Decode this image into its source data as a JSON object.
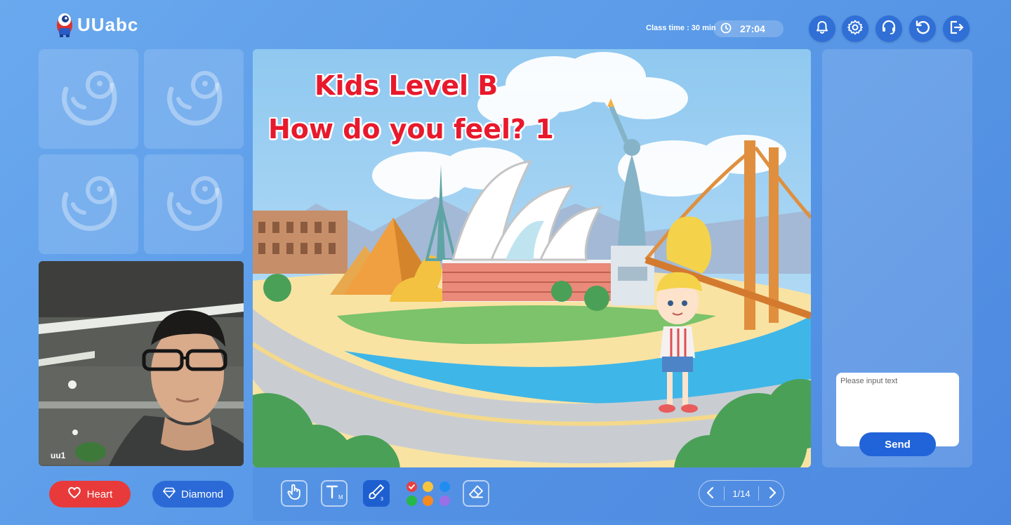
{
  "header": {
    "logo_text": "UUabc",
    "class_time_label": "Class time : 30 min",
    "timer": "27:04",
    "buttons": [
      {
        "name": "notifications-button",
        "icon": "bell-icon"
      },
      {
        "name": "settings-button",
        "icon": "gear-icon"
      },
      {
        "name": "support-button",
        "icon": "headset-icon"
      },
      {
        "name": "refresh-button",
        "icon": "refresh-icon"
      },
      {
        "name": "exit-button",
        "icon": "exit-icon"
      }
    ]
  },
  "students": {
    "video_label": "uu1"
  },
  "rewards": {
    "heart_label": "Heart",
    "diamond_label": "Diamond",
    "heart_color": "#e83a3a",
    "diamond_color": "#2b6ad6"
  },
  "slide": {
    "title_line1": "Kids Level B",
    "title_line2": "How do you feel? 1"
  },
  "toolbar": {
    "tools": [
      {
        "name": "pointer-tool",
        "icon": "hand-pointer-icon"
      },
      {
        "name": "text-tool",
        "icon": "text-icon",
        "badge": "M"
      },
      {
        "name": "pen-tool",
        "icon": "brush-icon",
        "badge": "3",
        "active": true
      },
      {
        "name": "eraser-tool",
        "icon": "eraser-icon"
      }
    ],
    "colors": [
      "#e84040",
      "#f7c53d",
      "#1f8cf0",
      "#27b84a",
      "#f58a1f",
      "#9a6fe8"
    ],
    "page_indicator": "1/14"
  },
  "chat": {
    "placeholder": "Please input text",
    "send_label": "Send"
  }
}
